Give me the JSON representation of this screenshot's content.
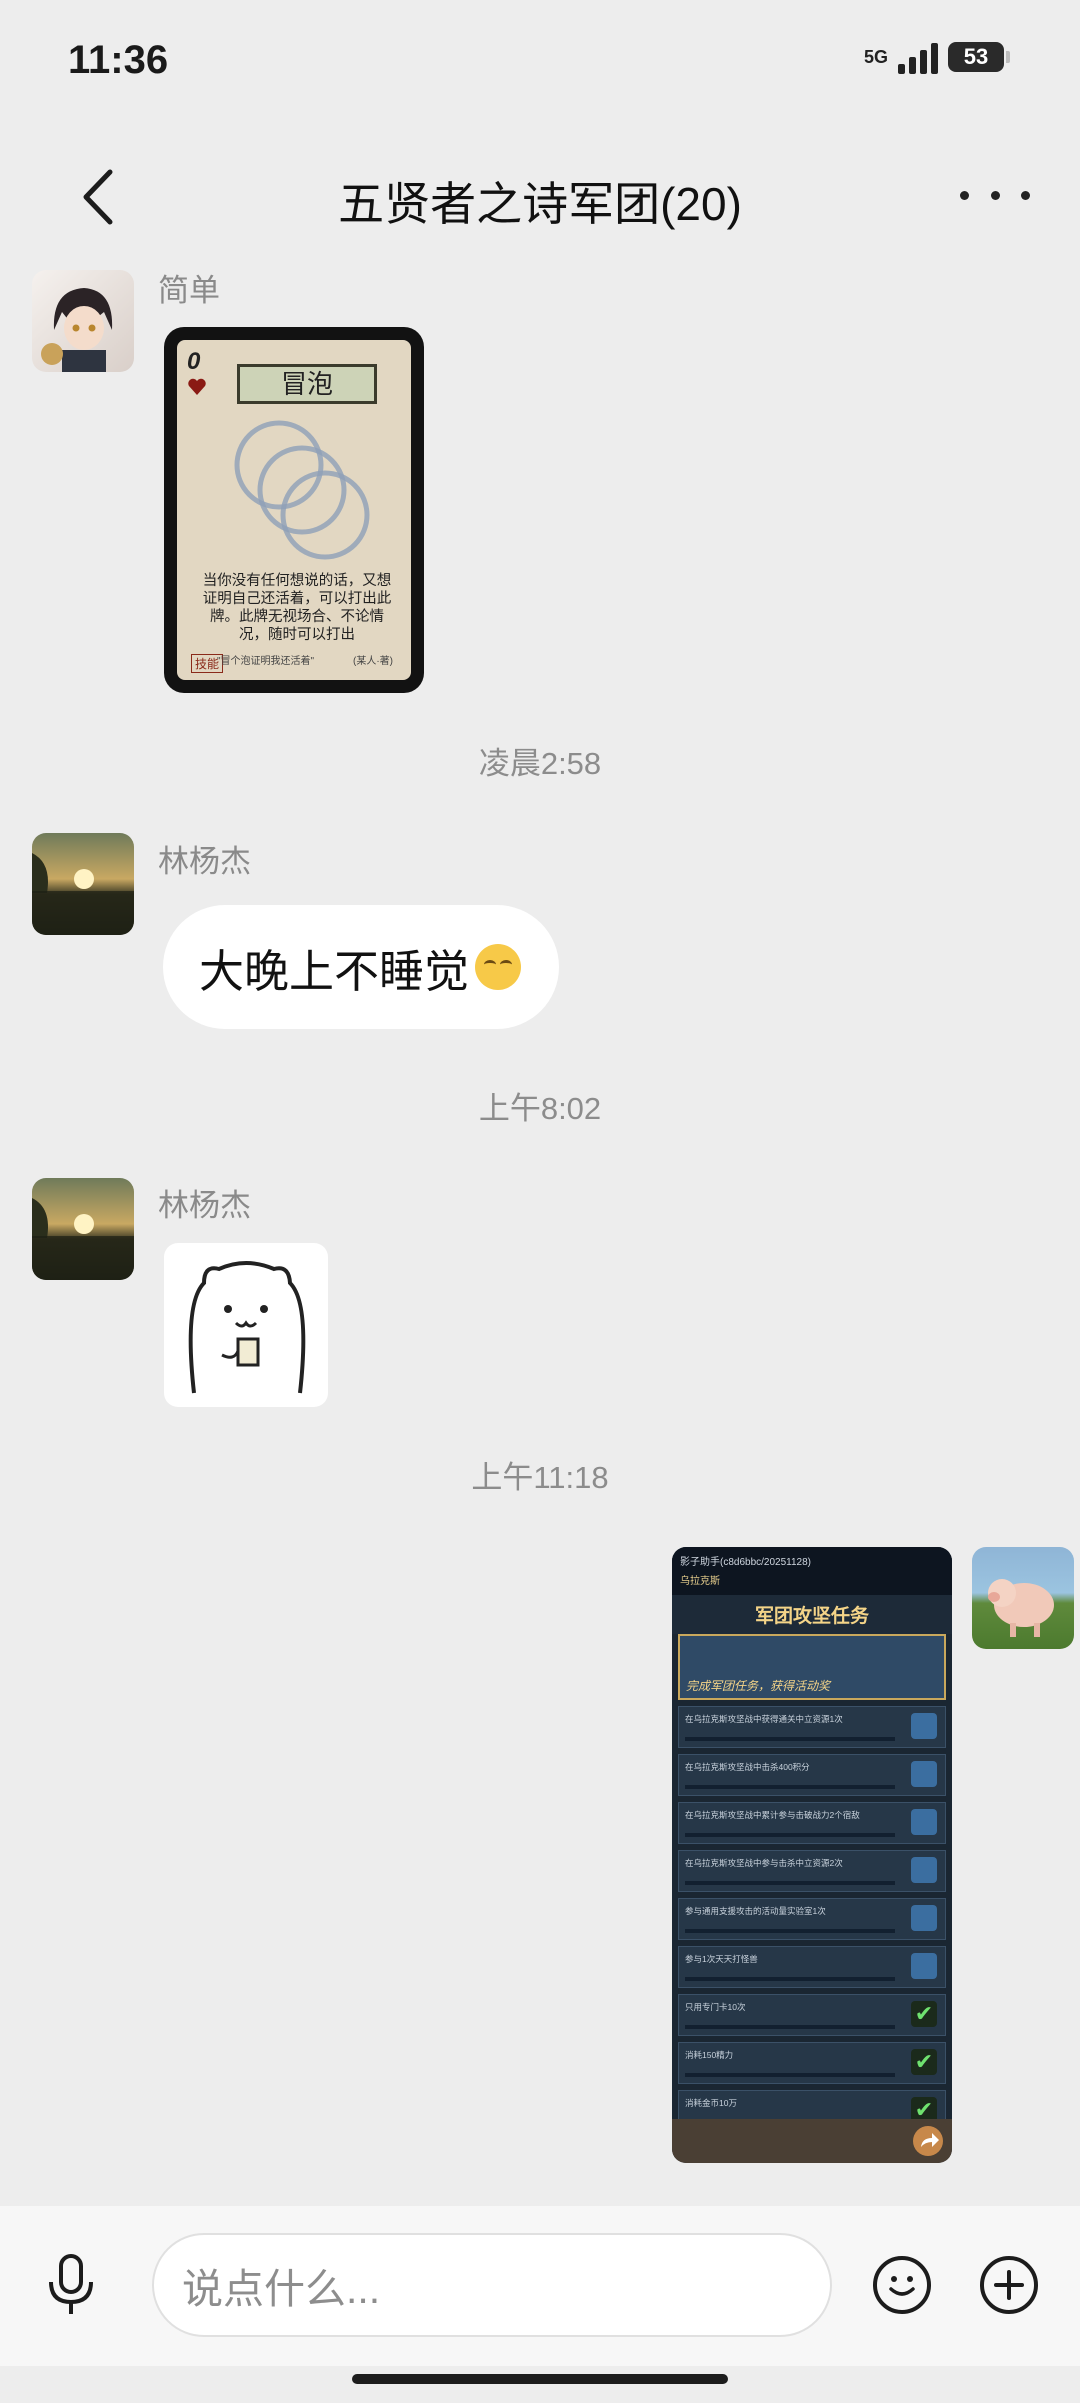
{
  "status_bar": {
    "time": "11:36",
    "network": "5G",
    "battery": "53"
  },
  "nav": {
    "title": "五贤者之诗军团(20)"
  },
  "messages": [
    {
      "sender": "简单",
      "type": "image",
      "card": {
        "num": "0",
        "title": "冒泡",
        "text": "当你没有任何想说的话，又想证明自己还活着，可以打出此牌。此牌无视场合、不论情况，随时可以打出",
        "sub": "\"冒个泡证明我还活着\"",
        "author": "(某人·著)",
        "tag": "技能"
      }
    },
    {
      "time": "凌晨2:58"
    },
    {
      "sender": "林杨杰",
      "type": "text",
      "text": "大晚上不睡觉"
    },
    {
      "time": "上午8:02"
    },
    {
      "sender": "林杨杰",
      "type": "sticker"
    },
    {
      "time": "上午11:18"
    },
    {
      "sender": "me",
      "type": "image",
      "shot": {
        "top_line": "影子助手(c8d6bbc/20251128)",
        "player": "乌拉克斯",
        "header": "军团攻坚任务",
        "banner": "完成军团任务，获得活动奖",
        "rows": [
          "在乌拉克斯攻坚战中获得通关中立资源1次",
          "在乌拉克斯攻坚战中击杀400积分",
          "在乌拉克斯攻坚战中累计参与击破战力2个宿敌",
          "在乌拉克斯攻坚战中参与击杀中立资源2次",
          "参与通用支援攻击的活动量实验室1次",
          "参与1次天天打怪兽",
          "只用专门卡10次",
          "消耗150精力",
          "消耗金币10万"
        ]
      }
    }
  ],
  "input": {
    "placeholder": "说点什么..."
  }
}
